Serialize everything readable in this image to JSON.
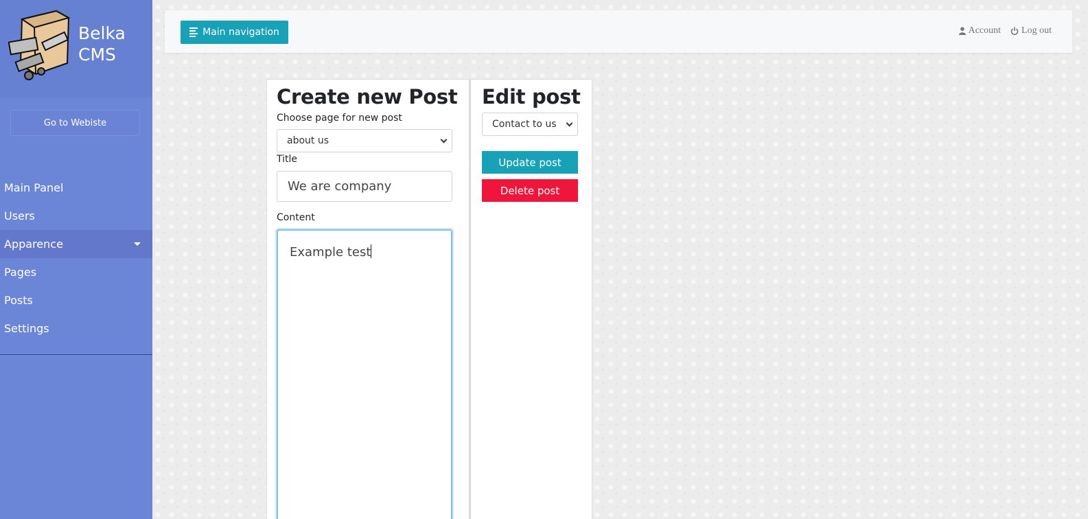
{
  "sidebar": {
    "brand_line1": "Belka",
    "brand_line2": "CMS",
    "go_to_website": "Go to Webiste",
    "items": [
      {
        "label": "Main Panel"
      },
      {
        "label": "Users"
      },
      {
        "label": "Apparence"
      },
      {
        "label": "Pages"
      },
      {
        "label": "Posts"
      },
      {
        "label": "Settings"
      }
    ]
  },
  "topbar": {
    "main_navigation": "Main navigation",
    "account": "Account",
    "logout": "Log out"
  },
  "create": {
    "title": "Create new Post",
    "choose_page_label": "Choose page for new post",
    "choose_page_value": "about us",
    "title_label": "Title",
    "title_value": "We are company",
    "content_label": "Content",
    "content_value": "Example test"
  },
  "edit": {
    "title": "Edit post",
    "select_value": "Contact to us",
    "update_label": "Update post",
    "delete_label": "Delete post"
  },
  "colors": {
    "sidebar": "#6b86d6",
    "accent": "#17a2b8",
    "danger": "#f0163b"
  }
}
